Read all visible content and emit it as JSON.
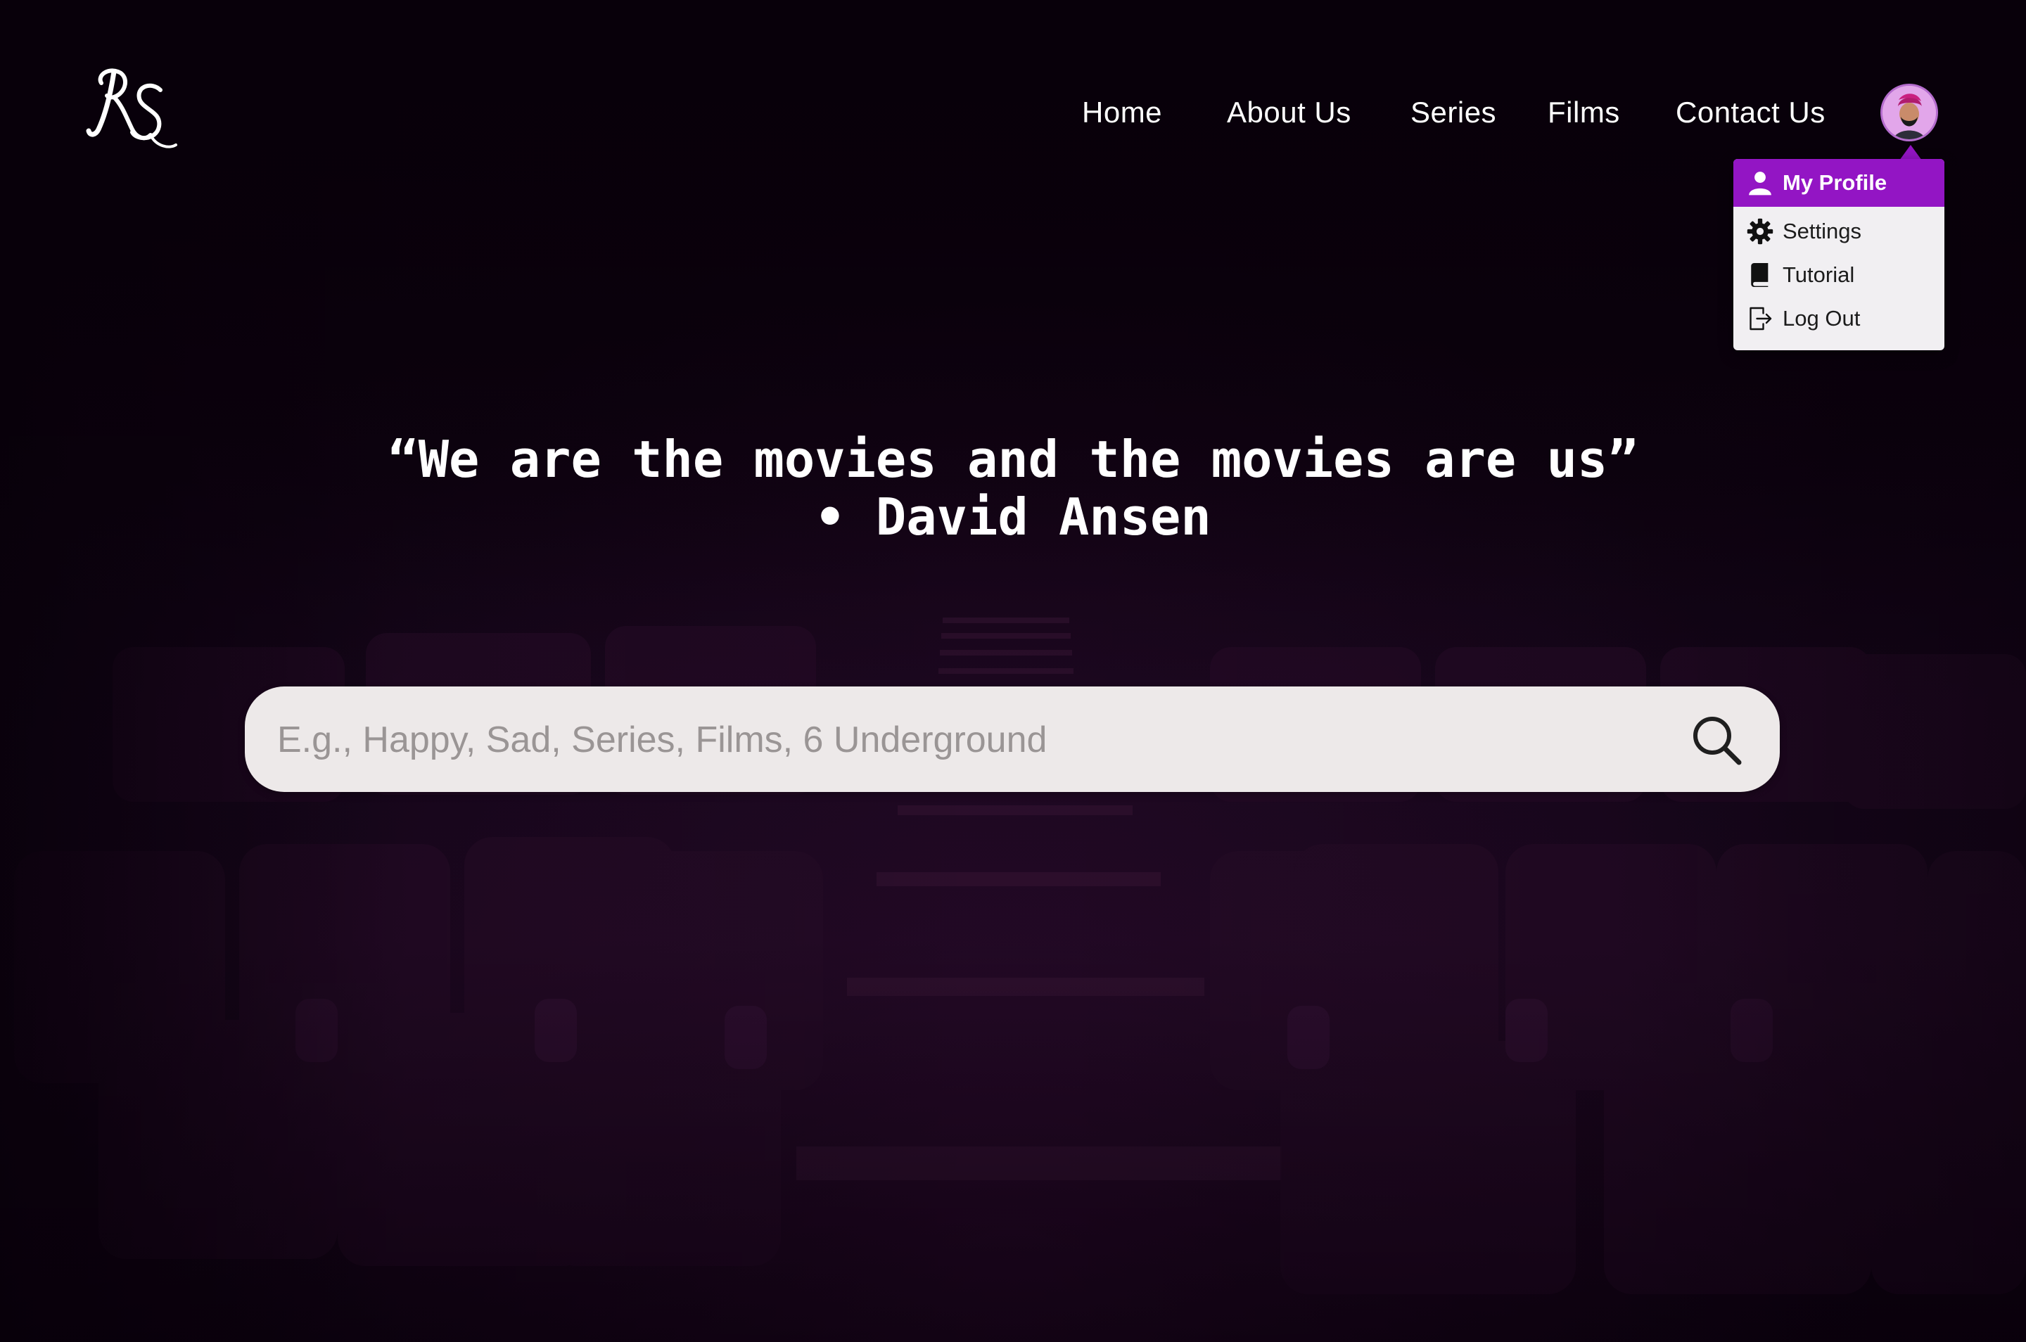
{
  "brand": {
    "logo_text": "RS"
  },
  "nav": {
    "items": [
      {
        "label": "Home"
      },
      {
        "label": "About Us"
      },
      {
        "label": "Series"
      },
      {
        "label": "Films"
      },
      {
        "label": "Contact Us"
      }
    ],
    "avatar_icon": "user-avatar"
  },
  "profile_menu": {
    "items": [
      {
        "label": "My Profile",
        "icon": "user-icon",
        "active": true
      },
      {
        "label": "Settings",
        "icon": "gear-icon"
      },
      {
        "label": "Tutorial",
        "icon": "book-icon"
      },
      {
        "label": "Log Out",
        "icon": "logout-icon"
      }
    ]
  },
  "hero": {
    "quote": "“We are the movies and the movies are us”",
    "author": "• David Ansen"
  },
  "search": {
    "placeholder": "E.g., Happy, Sad, Series, Films, 6 Underground",
    "value": "",
    "icon": "search-icon"
  },
  "colors": {
    "accent": "#9315c4",
    "background": "#0c0210",
    "menu_bg": "#f1eff2",
    "search_bg": "#ede9e9"
  }
}
